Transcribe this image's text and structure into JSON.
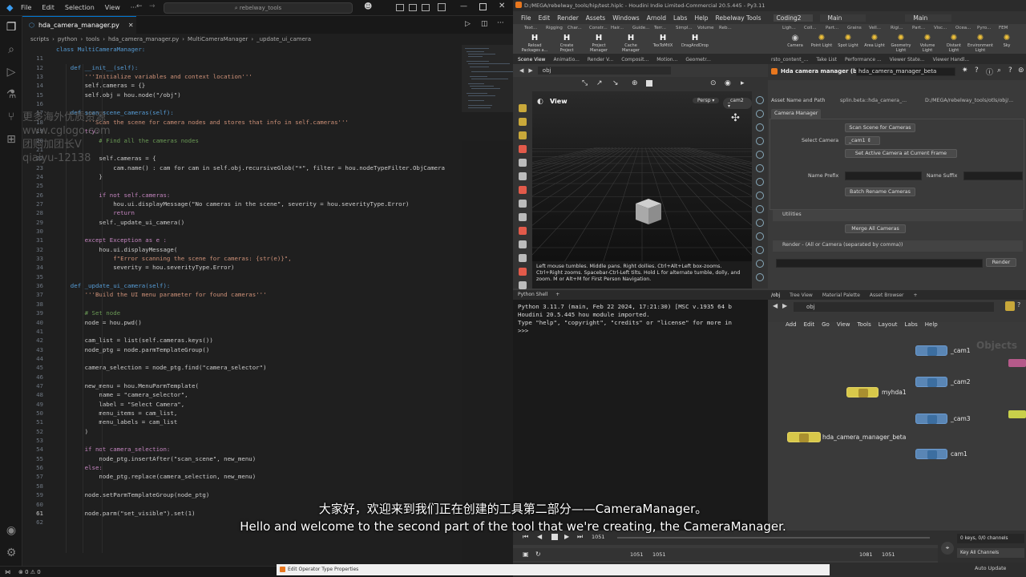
{
  "vscode": {
    "menu": [
      "File",
      "Edit",
      "Selection",
      "View",
      "···"
    ],
    "search": "rebelway_tools",
    "tab": "hda_camera_manager.py",
    "breadcrumb": [
      "scripts",
      "python",
      "tools",
      "hda_camera_manager.py",
      "MultiCameraManager",
      "_update_ui_camera"
    ],
    "lines": [
      {
        "n": "",
        "t": "class MultiCameraManager:"
      },
      {
        "n": "11",
        "t": ""
      },
      {
        "n": "12",
        "t": "    def __init__(self):"
      },
      {
        "n": "13",
        "t": "        '''Initialize variables and context location'''"
      },
      {
        "n": "14",
        "t": "        self.cameras = {}"
      },
      {
        "n": "15",
        "t": "        self.obj = hou.node(\"/obj\")"
      },
      {
        "n": "16",
        "t": ""
      },
      {
        "n": "17",
        "t": "    def scan_scene_cameras(self):"
      },
      {
        "n": "18",
        "t": "        '''Scan the scene for camera nodes and stores that info in self.cameras'''"
      },
      {
        "n": "19",
        "t": "        try:"
      },
      {
        "n": "20",
        "t": "            # Find all the cameras nodes"
      },
      {
        "n": "21",
        "t": ""
      },
      {
        "n": "22",
        "t": "            self.cameras = {"
      },
      {
        "n": "23",
        "t": "                cam.name() : cam for cam in self.obj.recursiveGlob(\"*\", filter = hou.nodeTypeFilter.ObjCamera"
      },
      {
        "n": "24",
        "t": "            }"
      },
      {
        "n": "25",
        "t": ""
      },
      {
        "n": "26",
        "t": "            if not self.cameras:"
      },
      {
        "n": "27",
        "t": "                hou.ui.displayMessage(\"No cameras in the scene\", severity = hou.severityType.Error)"
      },
      {
        "n": "28",
        "t": "                return"
      },
      {
        "n": "29",
        "t": "            self._update_ui_camera()"
      },
      {
        "n": "30",
        "t": ""
      },
      {
        "n": "31",
        "t": "        except Exception as e :"
      },
      {
        "n": "32",
        "t": "            hou.ui.displayMessage("
      },
      {
        "n": "33",
        "t": "                f\"Error scanning the scene for cameras: {str(e)}\","
      },
      {
        "n": "34",
        "t": "                severity = hou.severityType.Error)"
      },
      {
        "n": "35",
        "t": ""
      },
      {
        "n": "36",
        "t": "    def _update_ui_camera(self):"
      },
      {
        "n": "37",
        "t": "        '''Build the UI menu parameter for found cameras'''"
      },
      {
        "n": "38",
        "t": ""
      },
      {
        "n": "39",
        "t": "        # Set node"
      },
      {
        "n": "40",
        "t": "        node = hou.pwd()"
      },
      {
        "n": "41",
        "t": ""
      },
      {
        "n": "42",
        "t": "        cam_list = list(self.cameras.keys())"
      },
      {
        "n": "43",
        "t": "        node_ptg = node.parmTemplateGroup()"
      },
      {
        "n": "44",
        "t": ""
      },
      {
        "n": "45",
        "t": "        camera_selection = node_ptg.find(\"camera_selector\")"
      },
      {
        "n": "46",
        "t": ""
      },
      {
        "n": "47",
        "t": "        new_menu = hou.MenuParmTemplate("
      },
      {
        "n": "48",
        "t": "            name = \"camera_selector\","
      },
      {
        "n": "49",
        "t": "            label = \"Select Camera\","
      },
      {
        "n": "50",
        "t": "            menu_items = cam_list,"
      },
      {
        "n": "51",
        "t": "            menu_labels = cam_list"
      },
      {
        "n": "52",
        "t": "        )"
      },
      {
        "n": "53",
        "t": ""
      },
      {
        "n": "54",
        "t": "        if not camera_selection:"
      },
      {
        "n": "55",
        "t": "            node_ptg.insertAfter(\"scan_scene\", new_menu)"
      },
      {
        "n": "56",
        "t": "        else:"
      },
      {
        "n": "57",
        "t": "            node_ptg.replace(camera_selection, new_menu)"
      },
      {
        "n": "58",
        "t": ""
      },
      {
        "n": "59",
        "t": "        node.setParmTemplateGroup(node_ptg)"
      },
      {
        "n": "60",
        "t": ""
      },
      {
        "n": "61",
        "t": "        node.parm(\"set_visible\").set(1)"
      },
      {
        "n": "62",
        "t": ""
      }
    ],
    "status": [
      "⊗ 0 ⚠ 0"
    ]
  },
  "watermark": [
    "更多海外优质资源",
    "www.cglogo.com",
    "",
    "团购加团长V",
    "qiaiyu-12138"
  ],
  "houdini": {
    "title": "D:/MEGA/rebelway_tools/hip/test.hiplc - Houdini Indie Limited-Commercial 20.5.445 - Py3.11",
    "menu": [
      "File",
      "Edit",
      "Render",
      "Assets",
      "Windows",
      "Arnold",
      "Labs",
      "Help",
      "Rebelway Tools",
      "Coding2",
      "Main"
    ],
    "desktop_right": "Main",
    "shelf_tabs_left": [
      "Text...",
      "Rigging",
      "Char...",
      "Constr...",
      "Hair...",
      "Guide...",
      "Terr...",
      "Simpl...",
      "Volume",
      "Reb..."
    ],
    "shelf_tools_left": [
      "Reload Packages a...",
      "Create Project",
      "Project Manager",
      "Cache Manager",
      "TexToMtlX",
      "DragAndDrop"
    ],
    "shelf_tabs_right": [
      "Ligh...",
      "Coll...",
      "Part...",
      "Grains",
      "Vell...",
      "Rigi...",
      "Part...",
      "Visc...",
      "Ocea...",
      "Pyro...",
      "FEM"
    ],
    "shelf_tools_right": [
      "Camera",
      "Point Light",
      "Spot Light",
      "Area Light",
      "Geometry Light",
      "Volume Light",
      "Distant Light",
      "Environment Light",
      "Sky"
    ],
    "viewport_tabs": [
      "Scene View",
      "Animatio...",
      "Render V...",
      "Composit...",
      "Motion...",
      "Geometr..."
    ],
    "obj_path": "obj",
    "view_label": "View",
    "persp": "Persp",
    "cam": "_cam2",
    "viewport_msg": "Left mouse tumbles. Middle pans. Right dollies. Ctrl+Alt+Left box-zooms. Ctrl+Right zooms. Spacebar-Ctrl-Left tilts. Hold L for alternate tumble, dolly, and zoom. M or Alt+M for First Person Navigation.",
    "python_tab": "Python Shell",
    "python_lines": [
      "Python 3.11.7 (main, Feb 22 2024, 17:21:30) [MSC v.1935 64 b",
      "Houdini 20.5.445 hou module imported.",
      "Type \"help\", \"copyright\", \"credits\" or \"license\" for more in",
      ">>>"
    ],
    "param_tabs": [
      "rsto_content_...",
      "Take List",
      "Performance ...",
      "Viewer State...",
      "Viewer Handl..."
    ],
    "param": {
      "node_type": "Hda camera manager (beta)",
      "node_name": "hda_camera_manager_beta",
      "asset_label": "Asset Name and Path",
      "asset_name": "splin.beta::hda_camera_...",
      "asset_path": "D:/MEGA/rebelway_tools/otls/obj/...",
      "folder": "Camera Manager",
      "scan_btn": "Scan Scene for Cameras",
      "select_label": "Select Camera",
      "select_value": "_cam1",
      "set_active_btn": "Set Active Camera at Current Frame",
      "prefix_label": "Name Prefix",
      "suffix_label": "Name Suffix",
      "batch_btn": "Batch Rename Cameras",
      "utilities": "Utilities",
      "merge_btn": "Merge All Cameras",
      "render_label": "Render - (All or Camera (separated by comma))",
      "render_btn": "Render"
    },
    "ne_tabs": [
      "/obj",
      "Tree View",
      "Material Palette",
      "Asset Browser"
    ],
    "ne_menu": [
      "Add",
      "Edit",
      "Go",
      "View",
      "Tools",
      "Layout",
      "Labs",
      "Help"
    ],
    "ne_watermark": "Objects",
    "nodes": [
      "_cam1",
      "_cam2",
      "myhda1",
      "_cam3",
      "hda_camera_manager_beta",
      "cam1"
    ],
    "timeline": {
      "frame": "1051",
      "start": "1051",
      "end": "1051",
      "end2": "1081",
      "end3": "1051",
      "keys": "0 keys, 0/0 channels",
      "key_all": "Key All Channels",
      "auto_update": "Auto Update"
    },
    "taskbar_item": "Edit Operator Type Properties"
  },
  "subtitles": {
    "zh": "大家好，欢迎来到我们正在创建的工具第二部分——CameraManager。",
    "en": "Hello and welcome to the second part of the tool that we're creating, the CameraManager."
  },
  "colors": {
    "accent": "#0078d4",
    "node_blue": "#5a86b5",
    "node_yellow": "#d8c84a"
  }
}
